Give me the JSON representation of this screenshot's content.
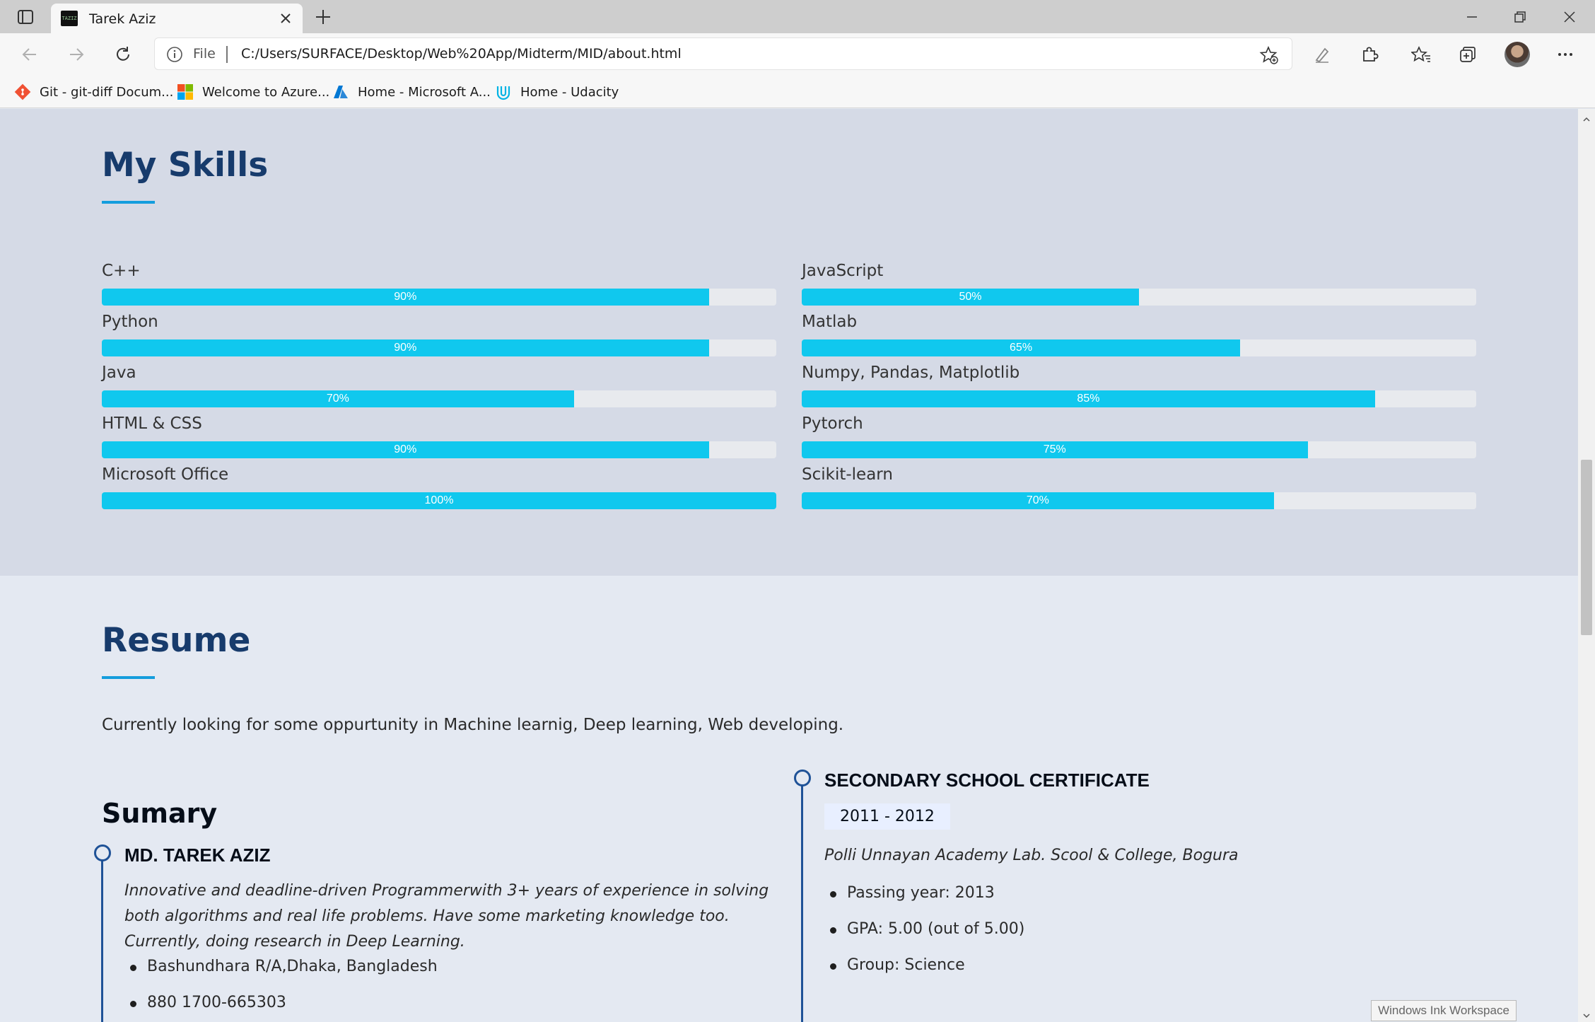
{
  "browser": {
    "tab_title": "Tarek Aziz",
    "favicon_text": "TAZIZ",
    "address_protocol": "File",
    "address_url": "C:/Users/SURFACE/Desktop/Web%20App/Midterm/MID/about.html",
    "bookmarks": [
      {
        "label": "Git - git-diff Docum...",
        "icon": "git-icon",
        "color": "#f05133"
      },
      {
        "label": "Welcome to Azure...",
        "icon": "microsoft-icon",
        "color": "#f25022"
      },
      {
        "label": "Home - Microsoft A...",
        "icon": "azure-icon",
        "color": "#0078d4"
      },
      {
        "label": "Home - Udacity",
        "icon": "udacity-icon",
        "color": "#02b3e4"
      }
    ]
  },
  "skills": {
    "title": "My Skills",
    "left": [
      {
        "name": "C++",
        "percent": 90,
        "label": "90%"
      },
      {
        "name": "Python",
        "percent": 90,
        "label": "90%"
      },
      {
        "name": "Java",
        "percent": 70,
        "label": "70%"
      },
      {
        "name": "HTML & CSS",
        "percent": 90,
        "label": "90%"
      },
      {
        "name": "Microsoft Office",
        "percent": 100,
        "label": "100%"
      }
    ],
    "right": [
      {
        "name": "JavaScript",
        "percent": 50,
        "label": "50%"
      },
      {
        "name": "Matlab",
        "percent": 65,
        "label": "65%"
      },
      {
        "name": "Numpy, Pandas, Matplotlib",
        "percent": 85,
        "label": "85%"
      },
      {
        "name": "Pytorch",
        "percent": 75,
        "label": "75%"
      },
      {
        "name": "Scikit-learn",
        "percent": 70,
        "label": "70%"
      }
    ],
    "bar_color": "#10c8ee"
  },
  "resume": {
    "title": "Resume",
    "intro": "Currently looking for some oppurtunity in Machine learnig, Deep learning, Web developing.",
    "summary_heading": "Sumary",
    "summary": {
      "name": "MD. TAREK AZIZ",
      "description": "Innovative and deadline-driven Programmerwith 3+ years of experience in solving both algorithms and real life problems. Have some marketing knowledge too. Currently, doing research in Deep Learning.",
      "bullets": [
        "Bashundhara R/A,Dhaka, Bangladesh",
        "880 1700-665303"
      ]
    },
    "education": {
      "title": "SECONDARY SCHOOL CERTIFICATE",
      "years": "2011 - 2012",
      "institution": "Polli Unnayan Academy Lab. Scool & College, Bogura",
      "bullets": [
        "Passing year: 2013",
        "GPA: 5.00 (out of 5.00)",
        "Group: Science"
      ]
    }
  },
  "overlay": {
    "ink_workspace": "Windows Ink Workspace"
  },
  "colors": {
    "heading": "#173b6c",
    "accent": "#149ddd",
    "timeline": "#1f5297"
  }
}
